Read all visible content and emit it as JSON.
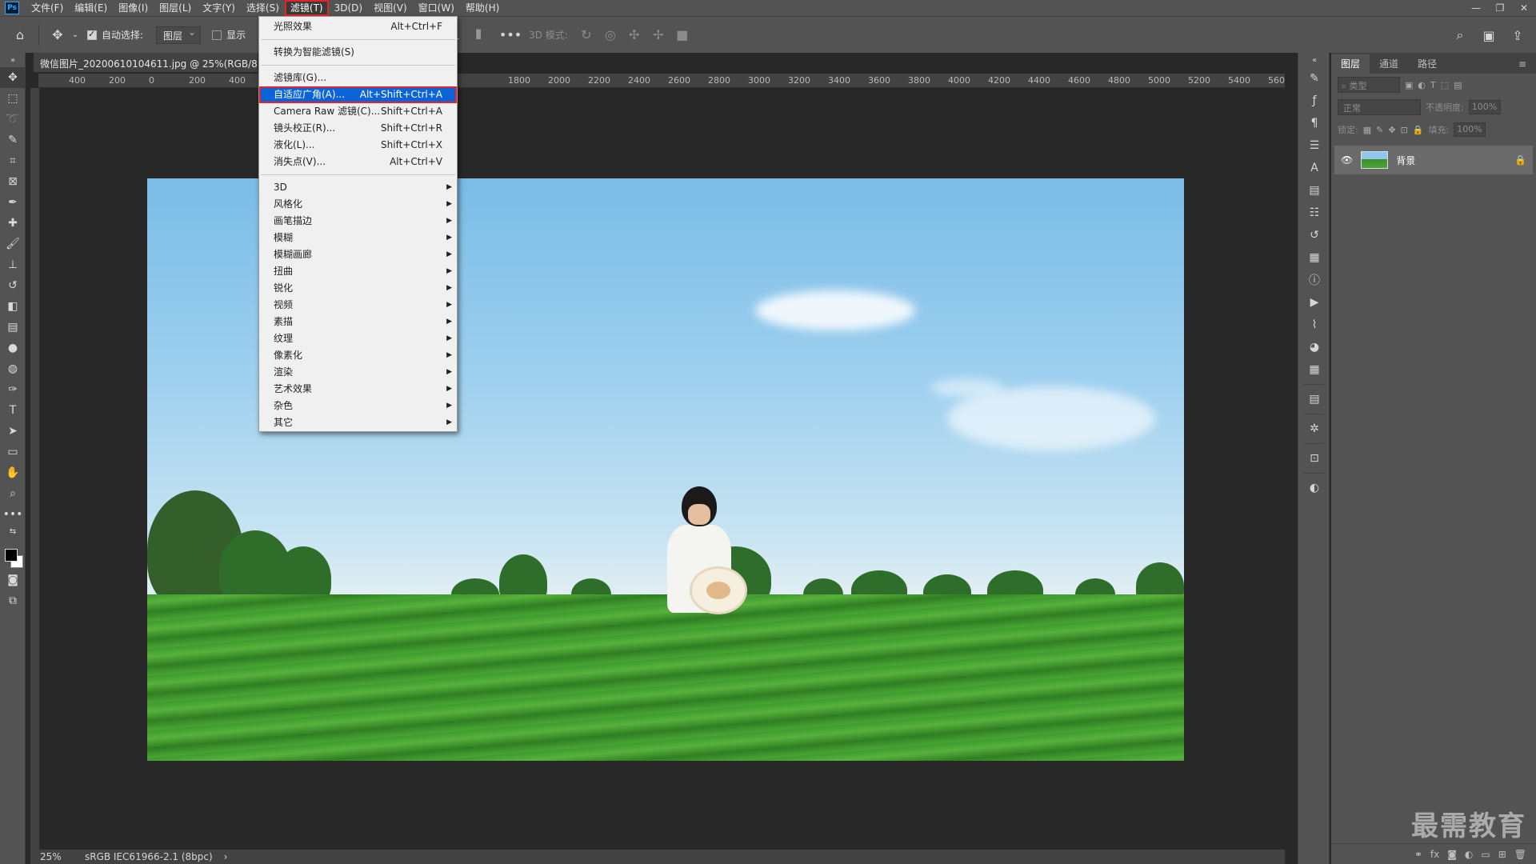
{
  "menubar": {
    "logo": "Ps",
    "items": [
      "文件(F)",
      "编辑(E)",
      "图像(I)",
      "图层(L)",
      "文字(Y)",
      "选择(S)",
      "滤镜(T)",
      "3D(D)",
      "视图(V)",
      "窗口(W)",
      "帮助(H)"
    ],
    "active_index": 6,
    "window_controls": [
      "minimize",
      "restore",
      "close"
    ]
  },
  "options": {
    "auto_select_label": "自动选择:",
    "auto_select_checked": true,
    "layer_select": "图层",
    "show_label": "显示",
    "mode_3d_label": "3D 模式:"
  },
  "document": {
    "tab_title": "微信图片_20200610104611.jpg @ 25%(RGB/8)",
    "ruler_ticks": [
      "400",
      "200",
      "0",
      "200",
      "400",
      "1800",
      "2000",
      "2200",
      "2400",
      "2600",
      "2800",
      "3000",
      "3200",
      "3400",
      "3600",
      "3800",
      "4000",
      "4200",
      "4400",
      "4600",
      "4800",
      "5000",
      "5200",
      "5400",
      "560"
    ],
    "zoom": "25%",
    "color_profile": "sRGB IEC61966-2.1 (8bpc)"
  },
  "filter_menu": {
    "items": [
      {
        "label": "光照效果",
        "shortcut": "Alt+Ctrl+F"
      },
      {
        "sep": true
      },
      {
        "label": "转换为智能滤镜(S)"
      },
      {
        "sep": true
      },
      {
        "label": "滤镜库(G)..."
      },
      {
        "label": "自适应广角(A)...",
        "shortcut": "Alt+Shift+Ctrl+A",
        "highlight": true
      },
      {
        "label": "Camera Raw 滤镜(C)...",
        "shortcut": "Shift+Ctrl+A"
      },
      {
        "label": "镜头校正(R)...",
        "shortcut": "Shift+Ctrl+R"
      },
      {
        "label": "液化(L)...",
        "shortcut": "Shift+Ctrl+X"
      },
      {
        "label": "消失点(V)...",
        "shortcut": "Alt+Ctrl+V"
      },
      {
        "sep": true
      },
      {
        "label": "3D",
        "submenu": true
      },
      {
        "label": "风格化",
        "submenu": true
      },
      {
        "label": "画笔描边",
        "submenu": true
      },
      {
        "label": "模糊",
        "submenu": true
      },
      {
        "label": "模糊画廊",
        "submenu": true
      },
      {
        "label": "扭曲",
        "submenu": true
      },
      {
        "label": "锐化",
        "submenu": true
      },
      {
        "label": "视频",
        "submenu": true
      },
      {
        "label": "素描",
        "submenu": true
      },
      {
        "label": "纹理",
        "submenu": true
      },
      {
        "label": "像素化",
        "submenu": true
      },
      {
        "label": "渲染",
        "submenu": true
      },
      {
        "label": "艺术效果",
        "submenu": true
      },
      {
        "label": "杂色",
        "submenu": true
      },
      {
        "label": "其它",
        "submenu": true
      }
    ]
  },
  "layers_panel": {
    "tabs": [
      "图层",
      "通道",
      "路径"
    ],
    "active_tab": 0,
    "filter_placeholder": "类型",
    "blend_mode": "正常",
    "opacity_label": "不透明度:",
    "opacity_value": "100%",
    "lock_label": "锁定:",
    "fill_label": "填充:",
    "fill_value": "100%",
    "layers": [
      {
        "name": "背景",
        "visible": true,
        "locked": true
      }
    ]
  },
  "watermark": "最需教育",
  "colors": {
    "ui_dark": "#535353",
    "canvas_bg": "#282828",
    "highlight_blue": "#0a64d8",
    "annotation_red": "#e1252b"
  }
}
